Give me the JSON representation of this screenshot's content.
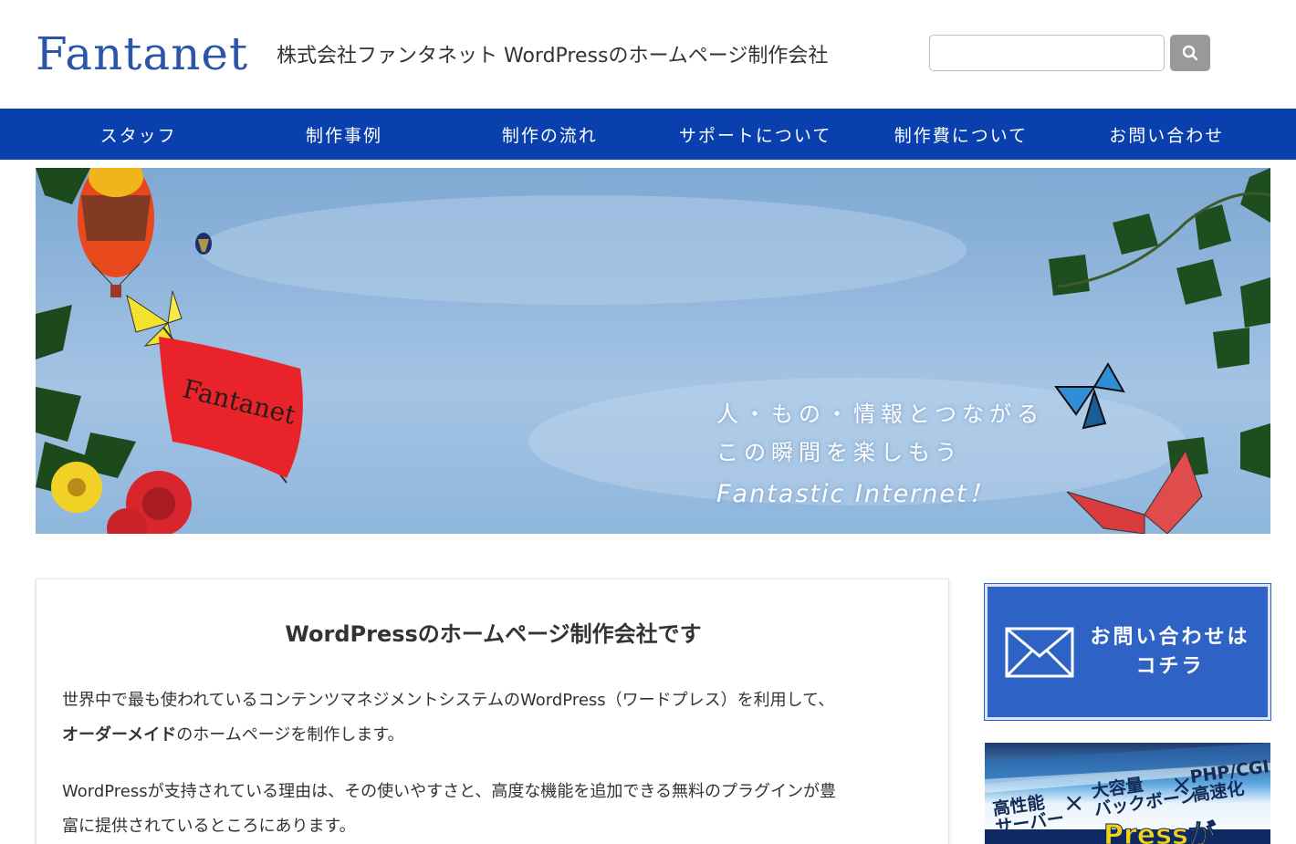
{
  "header": {
    "logo": "Fantanet",
    "tagline": "株式会社ファンタネット WordPressのホームページ制作会社",
    "search_placeholder": ""
  },
  "nav": {
    "items": [
      {
        "label": "スタッフ"
      },
      {
        "label": "制作事例"
      },
      {
        "label": "制作の流れ"
      },
      {
        "label": "サポートについて"
      },
      {
        "label": "制作費について"
      },
      {
        "label": "お問い合わせ"
      }
    ]
  },
  "hero": {
    "flag_text": "Fantanet",
    "line1": "人・もの・情報とつながる",
    "line2": "この瞬間を楽しもう",
    "line3": "Fantastic Internet！",
    "colors": {
      "sky": "#8db3da",
      "flag": "#e8242a",
      "nav": "#0a3fae"
    }
  },
  "main": {
    "title": "WordPressのホームページ制作会社です",
    "p1_line1": "世界中で最も使われているコンテンツマネジメントシステムのWordPress（ワードプレス）を利用して、",
    "p1_bold": "オーダーメイド",
    "p1_rest": "のホームページを制作します。",
    "p2_line1": "WordPressが支持されている理由は、その使いやすさと、高度な機能を追加できる無料のプラグインが豊",
    "p2_line2": "富に提供されているところにあります。"
  },
  "sidebar": {
    "contact_line1": "お問い合わせは",
    "contact_line2": "コチラ",
    "server_banner": {
      "t1": "高性能",
      "t2": "サーバー",
      "t3": "大容量",
      "t4": "バックボーン",
      "t5": "PHP/CGI",
      "t6": "高速化",
      "t7": "Pressが",
      "times": "×"
    }
  }
}
